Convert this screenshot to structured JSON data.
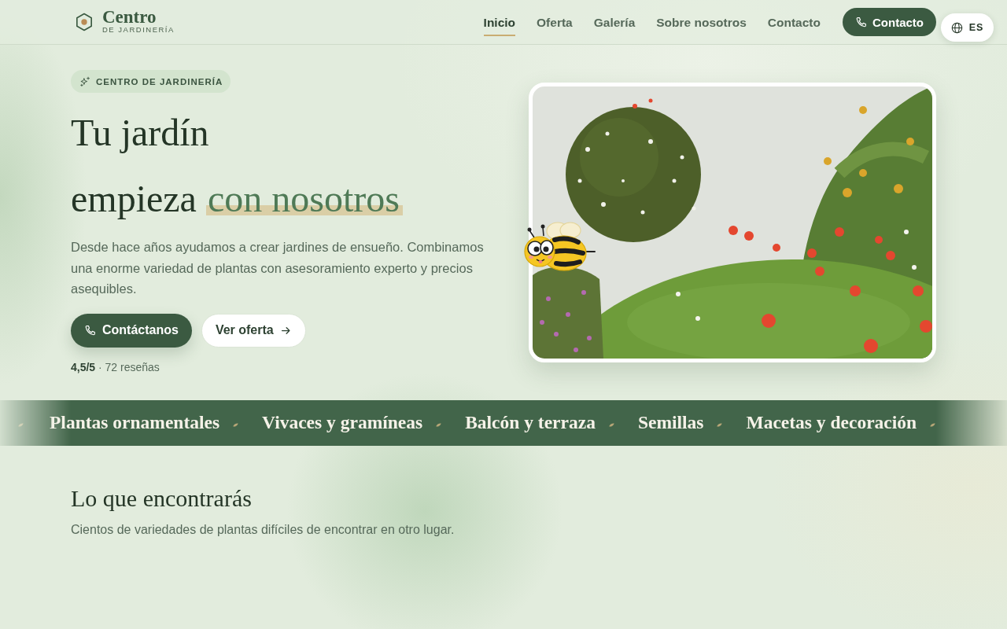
{
  "header": {
    "logo": {
      "title": "Centro",
      "subtitle": "DE JARDINERÍA"
    },
    "nav": [
      {
        "label": "Inicio",
        "selected": true
      },
      {
        "label": "Oferta",
        "selected": false
      },
      {
        "label": "Galería",
        "selected": false
      },
      {
        "label": "Sobre nosotros",
        "selected": false
      },
      {
        "label": "Contacto",
        "selected": false
      }
    ],
    "contact_button": {
      "label": "Contacto"
    },
    "language_button": {
      "label": "ES"
    }
  },
  "hero": {
    "badge": "CENTRO DE JARDINERÍA",
    "heading": {
      "lines": [
        "Tu jardín",
        "empieza"
      ],
      "highlight": "con nosotros"
    },
    "description": "Desde hace años ayudamos a crear jardines de ensueño. Combinamos una enorme variedad de plantas con asesoramiento experto y precios asequibles.",
    "buttons": [
      {
        "kind": "primary",
        "label": "Contáctanos"
      },
      {
        "kind": "secondary",
        "label": "Ver oferta"
      }
    ],
    "rating": "**4,5/5** · 72 reseñas"
  },
  "category_band": {
    "items": [
      "Plantas ornamentales",
      "Vivaces y gramíneas",
      "Balcón y terraza",
      "Semillas",
      "Macetas y decoración"
    ]
  },
  "section": {
    "title": "Lo que encontrarás",
    "subtitle": "Cientos de variedades de plantas difíciles de encontrar en otro lugar."
  }
}
